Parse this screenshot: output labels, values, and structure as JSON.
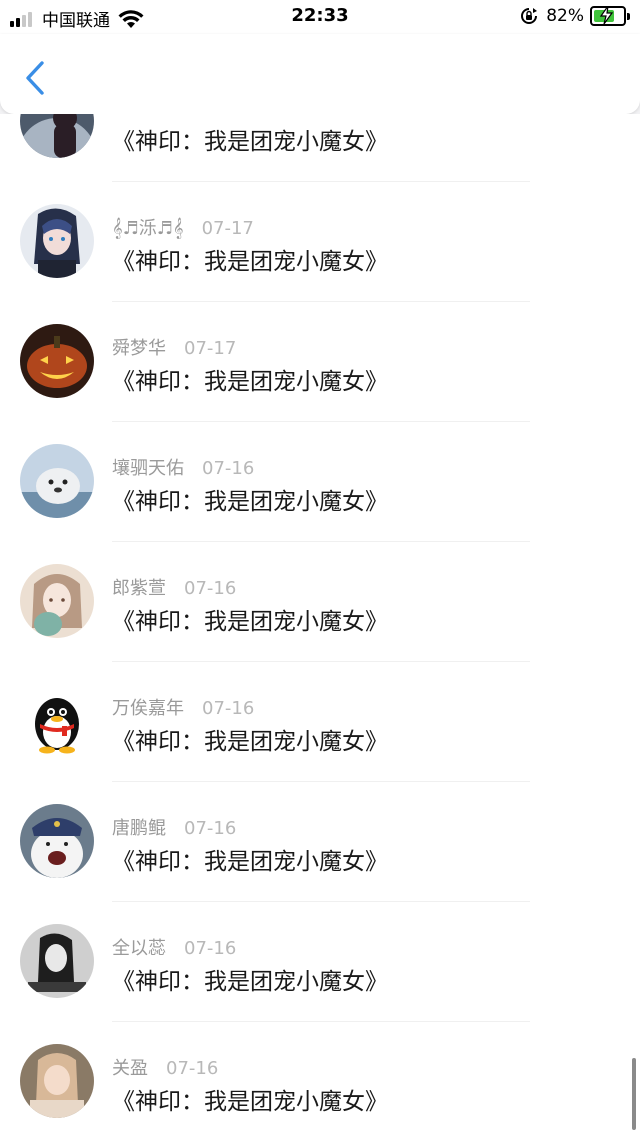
{
  "status_bar": {
    "carrier": "中国联通",
    "time": "22:33",
    "battery": "82%",
    "battery_level": 0.82
  },
  "nav": {
    "back_icon": "chevron-left-icon",
    "accent_color": "#3a8ee6"
  },
  "comments": [
    {
      "user": "",
      "date": "",
      "text": "《神印：我是团宠小魔女》",
      "avatar": "avatar-dark-figure"
    },
    {
      "user": "𝄞♬泺♬𝄞",
      "date": "07-17",
      "text": "《神印：我是团宠小魔女》",
      "avatar": "avatar-anime-girl"
    },
    {
      "user": "舜梦华",
      "date": "07-17",
      "text": "《神印：我是团宠小魔女》",
      "avatar": "avatar-pumpkin"
    },
    {
      "user": "壤驷天佑",
      "date": "07-16",
      "text": "《神印：我是团宠小魔女》",
      "avatar": "avatar-seal"
    },
    {
      "user": "郎紫萱",
      "date": "07-16",
      "text": "《神印：我是团宠小魔女》",
      "avatar": "avatar-illustration-girl"
    },
    {
      "user": "万俟嘉年",
      "date": "07-16",
      "text": "《神印：我是团宠小魔女》",
      "avatar": "avatar-qq-penguin"
    },
    {
      "user": "唐鹏鲲",
      "date": "07-16",
      "text": "《神印：我是团宠小魔女》",
      "avatar": "avatar-cartoon-bear"
    },
    {
      "user": "全以蕊",
      "date": "07-16",
      "text": "《神印：我是团宠小魔女》",
      "avatar": "avatar-bw-photo"
    },
    {
      "user": "关盈",
      "date": "07-16",
      "text": "《神印：我是团宠小魔女》",
      "avatar": "avatar-photo-girl"
    }
  ]
}
